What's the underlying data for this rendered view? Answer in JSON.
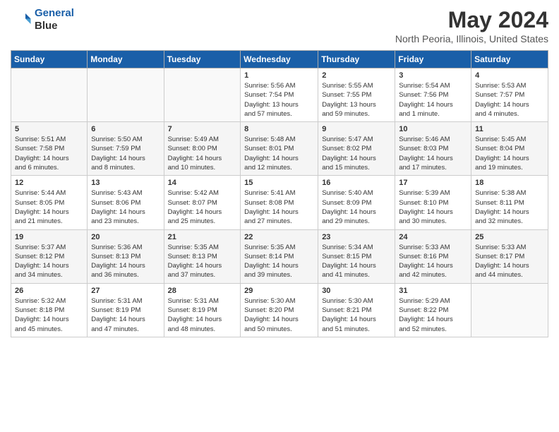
{
  "header": {
    "logo_line1": "General",
    "logo_line2": "Blue",
    "month_year": "May 2024",
    "location": "North Peoria, Illinois, United States"
  },
  "days_of_week": [
    "Sunday",
    "Monday",
    "Tuesday",
    "Wednesday",
    "Thursday",
    "Friday",
    "Saturday"
  ],
  "weeks": [
    [
      {
        "day": "",
        "detail": ""
      },
      {
        "day": "",
        "detail": ""
      },
      {
        "day": "",
        "detail": ""
      },
      {
        "day": "1",
        "detail": "Sunrise: 5:56 AM\nSunset: 7:54 PM\nDaylight: 13 hours\nand 57 minutes."
      },
      {
        "day": "2",
        "detail": "Sunrise: 5:55 AM\nSunset: 7:55 PM\nDaylight: 13 hours\nand 59 minutes."
      },
      {
        "day": "3",
        "detail": "Sunrise: 5:54 AM\nSunset: 7:56 PM\nDaylight: 14 hours\nand 1 minute."
      },
      {
        "day": "4",
        "detail": "Sunrise: 5:53 AM\nSunset: 7:57 PM\nDaylight: 14 hours\nand 4 minutes."
      }
    ],
    [
      {
        "day": "5",
        "detail": "Sunrise: 5:51 AM\nSunset: 7:58 PM\nDaylight: 14 hours\nand 6 minutes."
      },
      {
        "day": "6",
        "detail": "Sunrise: 5:50 AM\nSunset: 7:59 PM\nDaylight: 14 hours\nand 8 minutes."
      },
      {
        "day": "7",
        "detail": "Sunrise: 5:49 AM\nSunset: 8:00 PM\nDaylight: 14 hours\nand 10 minutes."
      },
      {
        "day": "8",
        "detail": "Sunrise: 5:48 AM\nSunset: 8:01 PM\nDaylight: 14 hours\nand 12 minutes."
      },
      {
        "day": "9",
        "detail": "Sunrise: 5:47 AM\nSunset: 8:02 PM\nDaylight: 14 hours\nand 15 minutes."
      },
      {
        "day": "10",
        "detail": "Sunrise: 5:46 AM\nSunset: 8:03 PM\nDaylight: 14 hours\nand 17 minutes."
      },
      {
        "day": "11",
        "detail": "Sunrise: 5:45 AM\nSunset: 8:04 PM\nDaylight: 14 hours\nand 19 minutes."
      }
    ],
    [
      {
        "day": "12",
        "detail": "Sunrise: 5:44 AM\nSunset: 8:05 PM\nDaylight: 14 hours\nand 21 minutes."
      },
      {
        "day": "13",
        "detail": "Sunrise: 5:43 AM\nSunset: 8:06 PM\nDaylight: 14 hours\nand 23 minutes."
      },
      {
        "day": "14",
        "detail": "Sunrise: 5:42 AM\nSunset: 8:07 PM\nDaylight: 14 hours\nand 25 minutes."
      },
      {
        "day": "15",
        "detail": "Sunrise: 5:41 AM\nSunset: 8:08 PM\nDaylight: 14 hours\nand 27 minutes."
      },
      {
        "day": "16",
        "detail": "Sunrise: 5:40 AM\nSunset: 8:09 PM\nDaylight: 14 hours\nand 29 minutes."
      },
      {
        "day": "17",
        "detail": "Sunrise: 5:39 AM\nSunset: 8:10 PM\nDaylight: 14 hours\nand 30 minutes."
      },
      {
        "day": "18",
        "detail": "Sunrise: 5:38 AM\nSunset: 8:11 PM\nDaylight: 14 hours\nand 32 minutes."
      }
    ],
    [
      {
        "day": "19",
        "detail": "Sunrise: 5:37 AM\nSunset: 8:12 PM\nDaylight: 14 hours\nand 34 minutes."
      },
      {
        "day": "20",
        "detail": "Sunrise: 5:36 AM\nSunset: 8:13 PM\nDaylight: 14 hours\nand 36 minutes."
      },
      {
        "day": "21",
        "detail": "Sunrise: 5:35 AM\nSunset: 8:13 PM\nDaylight: 14 hours\nand 37 minutes."
      },
      {
        "day": "22",
        "detail": "Sunrise: 5:35 AM\nSunset: 8:14 PM\nDaylight: 14 hours\nand 39 minutes."
      },
      {
        "day": "23",
        "detail": "Sunrise: 5:34 AM\nSunset: 8:15 PM\nDaylight: 14 hours\nand 41 minutes."
      },
      {
        "day": "24",
        "detail": "Sunrise: 5:33 AM\nSunset: 8:16 PM\nDaylight: 14 hours\nand 42 minutes."
      },
      {
        "day": "25",
        "detail": "Sunrise: 5:33 AM\nSunset: 8:17 PM\nDaylight: 14 hours\nand 44 minutes."
      }
    ],
    [
      {
        "day": "26",
        "detail": "Sunrise: 5:32 AM\nSunset: 8:18 PM\nDaylight: 14 hours\nand 45 minutes."
      },
      {
        "day": "27",
        "detail": "Sunrise: 5:31 AM\nSunset: 8:19 PM\nDaylight: 14 hours\nand 47 minutes."
      },
      {
        "day": "28",
        "detail": "Sunrise: 5:31 AM\nSunset: 8:19 PM\nDaylight: 14 hours\nand 48 minutes."
      },
      {
        "day": "29",
        "detail": "Sunrise: 5:30 AM\nSunset: 8:20 PM\nDaylight: 14 hours\nand 50 minutes."
      },
      {
        "day": "30",
        "detail": "Sunrise: 5:30 AM\nSunset: 8:21 PM\nDaylight: 14 hours\nand 51 minutes."
      },
      {
        "day": "31",
        "detail": "Sunrise: 5:29 AM\nSunset: 8:22 PM\nDaylight: 14 hours\nand 52 minutes."
      },
      {
        "day": "",
        "detail": ""
      }
    ]
  ]
}
